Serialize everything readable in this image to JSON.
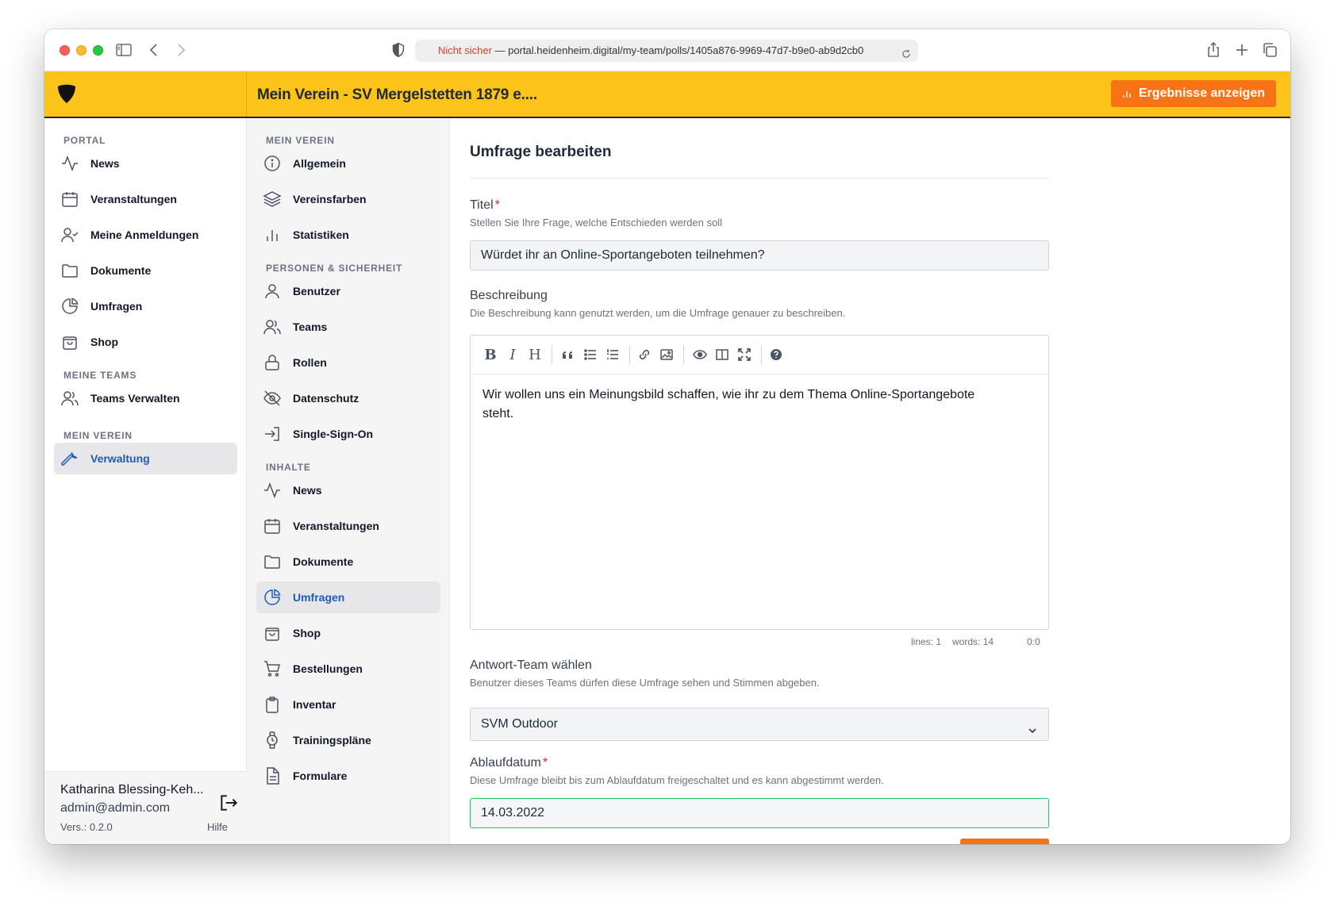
{
  "browser": {
    "url_prefix": "Nicht sicher",
    "url_separator": " — ",
    "url": "portal.heidenheim.digital/my-team/polls/1405a876-9969-47d7-b9e0-ab9d2cb0"
  },
  "header": {
    "title": "Mein Verein - SV Mergelstetten 1879 e....",
    "results_button": "Ergebnisse anzeigen",
    "accent_color": "#fcc419",
    "button_color": "#f97316"
  },
  "sidebar_left": {
    "sections": [
      {
        "label": "PORTAL",
        "items": [
          {
            "label": "News",
            "icon": "activity-icon"
          },
          {
            "label": "Veranstaltungen",
            "icon": "calendar-icon"
          },
          {
            "label": "Meine Anmeldungen",
            "icon": "user-check-icon"
          },
          {
            "label": "Dokumente",
            "icon": "folder-icon"
          },
          {
            "label": "Umfragen",
            "icon": "pie-chart-icon"
          },
          {
            "label": "Shop",
            "icon": "shopping-bag-icon"
          }
        ]
      },
      {
        "label": "MEINE TEAMS",
        "items": [
          {
            "label": "Teams Verwalten",
            "icon": "users-icon"
          }
        ]
      },
      {
        "label": "MEIN VEREIN",
        "items": [
          {
            "label": "Verwaltung",
            "icon": "wrench-icon",
            "active": true
          }
        ]
      }
    ],
    "user": {
      "name": "Katharina Blessing-Keh...",
      "email": "admin@admin.com",
      "version": "Vers.: 0.2.0",
      "help": "Hilfe"
    }
  },
  "sidebar_mid": {
    "sections": [
      {
        "label": "MEIN VEREIN",
        "items": [
          {
            "label": "Allgemein",
            "icon": "info-icon"
          },
          {
            "label": "Vereinsfarben",
            "icon": "layers-icon"
          },
          {
            "label": "Statistiken",
            "icon": "bar-chart-icon"
          }
        ]
      },
      {
        "label": "PERSONEN & SICHERHEIT",
        "items": [
          {
            "label": "Benutzer",
            "icon": "user-icon"
          },
          {
            "label": "Teams",
            "icon": "users-icon"
          },
          {
            "label": "Rollen",
            "icon": "lock-icon"
          },
          {
            "label": "Datenschutz",
            "icon": "eye-off-icon"
          },
          {
            "label": "Single-Sign-On",
            "icon": "log-in-icon"
          }
        ]
      },
      {
        "label": "INHALTE",
        "items": [
          {
            "label": "News",
            "icon": "activity-icon"
          },
          {
            "label": "Veranstaltungen",
            "icon": "calendar-icon"
          },
          {
            "label": "Dokumente",
            "icon": "folder-icon"
          },
          {
            "label": "Umfragen",
            "icon": "pie-chart-icon",
            "active": true
          },
          {
            "label": "Shop",
            "icon": "shopping-bag-icon"
          },
          {
            "label": "Bestellungen",
            "icon": "shopping-cart-icon"
          },
          {
            "label": "Inventar",
            "icon": "clipboard-icon"
          },
          {
            "label": "Trainingspläne",
            "icon": "watch-icon"
          },
          {
            "label": "Formulare",
            "icon": "file-text-icon"
          }
        ]
      }
    ]
  },
  "form": {
    "page_title": "Umfrage bearbeiten",
    "title_field": {
      "label": "Titel",
      "required": "*",
      "help": "Stellen Sie Ihre Frage, welche Entschieden werden soll",
      "value": "Würdet ihr an Online-Sportangeboten teilnehmen?"
    },
    "description_field": {
      "label": "Beschreibung",
      "help": "Die Beschreibung kann genutzt werden, um die Umfrage genauer zu beschreiben.",
      "value": "Wir wollen uns ein Meinungsbild schaffen, wie ihr zu dem Thema Online-Sportangebote steht.",
      "status_lines": "lines: 1",
      "status_words": "words: 14",
      "status_cursor": "0:0"
    },
    "team_field": {
      "label": "Antwort-Team wählen",
      "help": "Benutzer dieses Teams dürfen diese Umfrage sehen und Stimmen abgeben.",
      "value": "SVM Outdoor"
    },
    "expiry_field": {
      "label": "Ablaufdatum",
      "required": "*",
      "help": "Diese Umfrage bleibt bis zum Ablaufdatum freigeschaltet und es kann abgestimmt werden.",
      "value": "14.03.2022"
    }
  }
}
